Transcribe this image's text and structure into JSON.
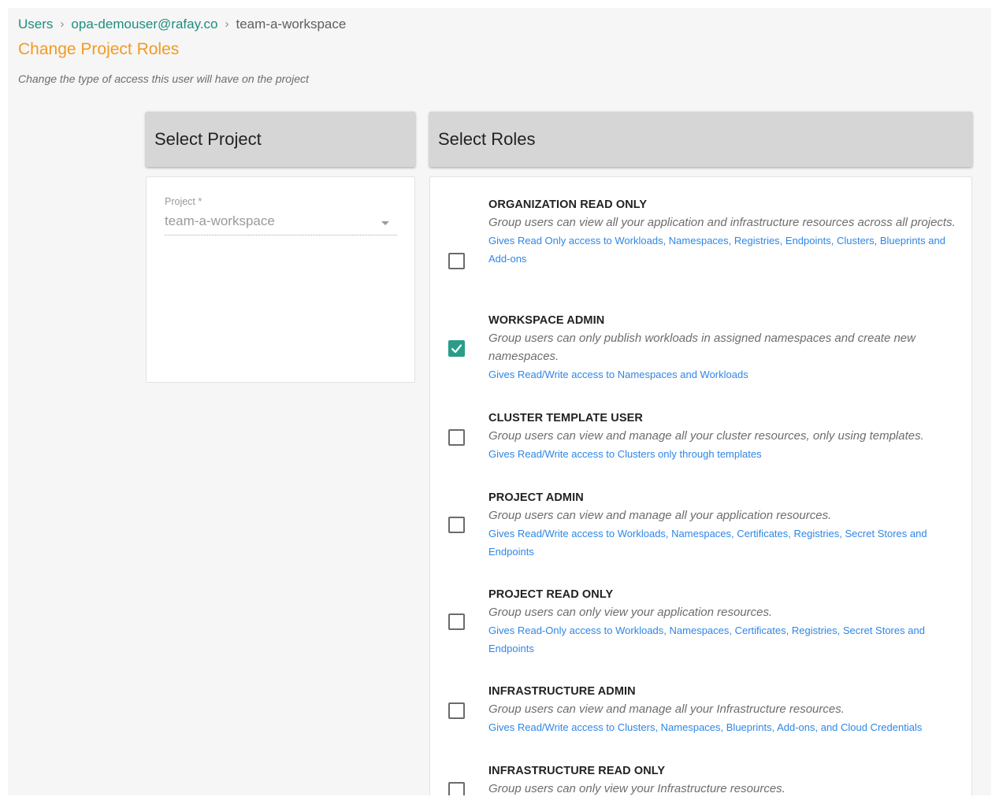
{
  "breadcrumb": {
    "users": "Users",
    "user": "opa-demouser@rafay.co",
    "current": "team-a-workspace",
    "sep": "›"
  },
  "page": {
    "title": "Change Project Roles",
    "subtitle": "Change the type of access this user will have on the project"
  },
  "project_panel": {
    "header": "Select Project",
    "field_label": "Project *",
    "field_value": "team-a-workspace"
  },
  "roles_panel": {
    "header": "Select Roles",
    "roles": [
      {
        "name": "ORGANIZATION READ ONLY",
        "description": "Group users can view all your application and infrastructure resources across all projects.",
        "access": "Gives Read Only access to Workloads, Namespaces, Registries, Endpoints, Clusters, Blueprints and Add-ons",
        "checked": false
      },
      {
        "name": "WORKSPACE ADMIN",
        "description": "Group users can only publish workloads in assigned namespaces and create new namespaces.",
        "access": "Gives Read/Write access to Namespaces and Workloads",
        "checked": true
      },
      {
        "name": "CLUSTER TEMPLATE USER",
        "description": "Group users can view and manage all your cluster resources, only using templates.",
        "access": "Gives Read/Write access to Clusters only through templates",
        "checked": false
      },
      {
        "name": "PROJECT ADMIN",
        "description": "Group users can view and manage all your application resources.",
        "access": "Gives Read/Write access to Workloads, Namespaces, Certificates, Registries, Secret Stores and Endpoints",
        "checked": false
      },
      {
        "name": "PROJECT READ ONLY",
        "description": "Group users can only view your application resources.",
        "access": "Gives Read-Only access to Workloads, Namespaces, Certificates, Registries, Secret Stores and Endpoints",
        "checked": false
      },
      {
        "name": "INFRASTRUCTURE ADMIN",
        "description": "Group users can view and manage all your Infrastructure resources.",
        "access": "Gives Read/Write access to Clusters, Namespaces, Blueprints, Add-ons, and Cloud Credentials",
        "checked": false
      },
      {
        "name": "INFRASTRUCTURE READ ONLY",
        "description": "Group users can only view your Infrastructure resources.",
        "access": "",
        "checked": false
      }
    ]
  },
  "colors": {
    "brand_link": "#1e8e7e",
    "title_accent": "#f29b23",
    "access_link": "#2f86e6",
    "checkbox_checked": "#2a9d8a"
  }
}
